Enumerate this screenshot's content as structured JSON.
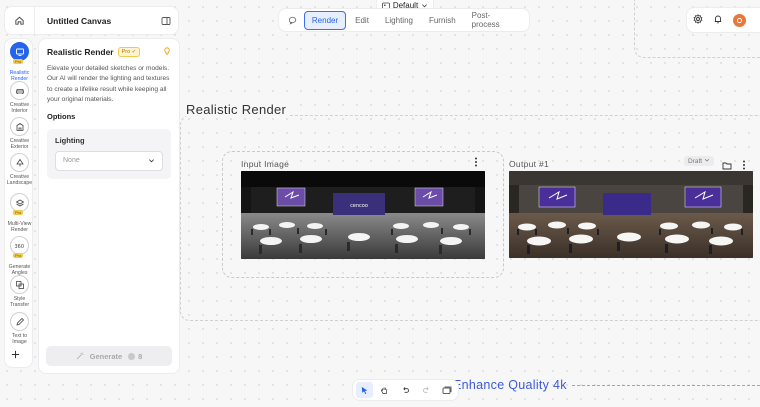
{
  "header": {
    "canvas_name": "Untitled Canvas",
    "workspace": "Default"
  },
  "toolbar": {
    "tabs": [
      {
        "label": "Render",
        "active": true
      },
      {
        "label": "Edit",
        "active": false
      },
      {
        "label": "Lighting",
        "active": false
      },
      {
        "label": "Furnish",
        "active": false
      },
      {
        "label": "Post-process",
        "active": false
      }
    ]
  },
  "rail": {
    "tools": [
      {
        "label": "Realistic Render",
        "icon": "render-icon",
        "pro": "Pro",
        "active": true
      },
      {
        "label": "Creative Interior",
        "icon": "sofa-icon"
      },
      {
        "label": "Creative Exterior",
        "icon": "building-icon"
      },
      {
        "label": "Creative Landscape",
        "icon": "tree-icon"
      },
      {
        "label": "Multi-View Render",
        "icon": "layers-icon",
        "pro": "Pro"
      },
      {
        "label": "Generate Angles",
        "icon": "rotate-360-icon",
        "pro": "Pro"
      },
      {
        "label": "Style Transfer",
        "icon": "style-icon"
      },
      {
        "label": "Text to Image",
        "icon": "pen-icon"
      }
    ]
  },
  "panel": {
    "title": "Realistic Render",
    "pro_badge": "Pro",
    "description": "Elevate your detailed sketches or models. Our AI will render the lighting and textures to create a lifelike result while keeping all your original materials.",
    "options_heading": "Options",
    "lighting_label": "Lighting",
    "lighting_value": "None",
    "generate_label": "Generate",
    "generate_cost": "8"
  },
  "canvas": {
    "board_title": "Realistic Render",
    "input_label": "Input Image",
    "output_label": "Output #1",
    "draft_label": "Draft",
    "enhance_label": "Enhance Quality 4k",
    "screen_logo_text": "cencoo"
  },
  "colors": {
    "accent": "#2563eb",
    "pro": "#f2c94c",
    "avatar": "#e8773a"
  }
}
